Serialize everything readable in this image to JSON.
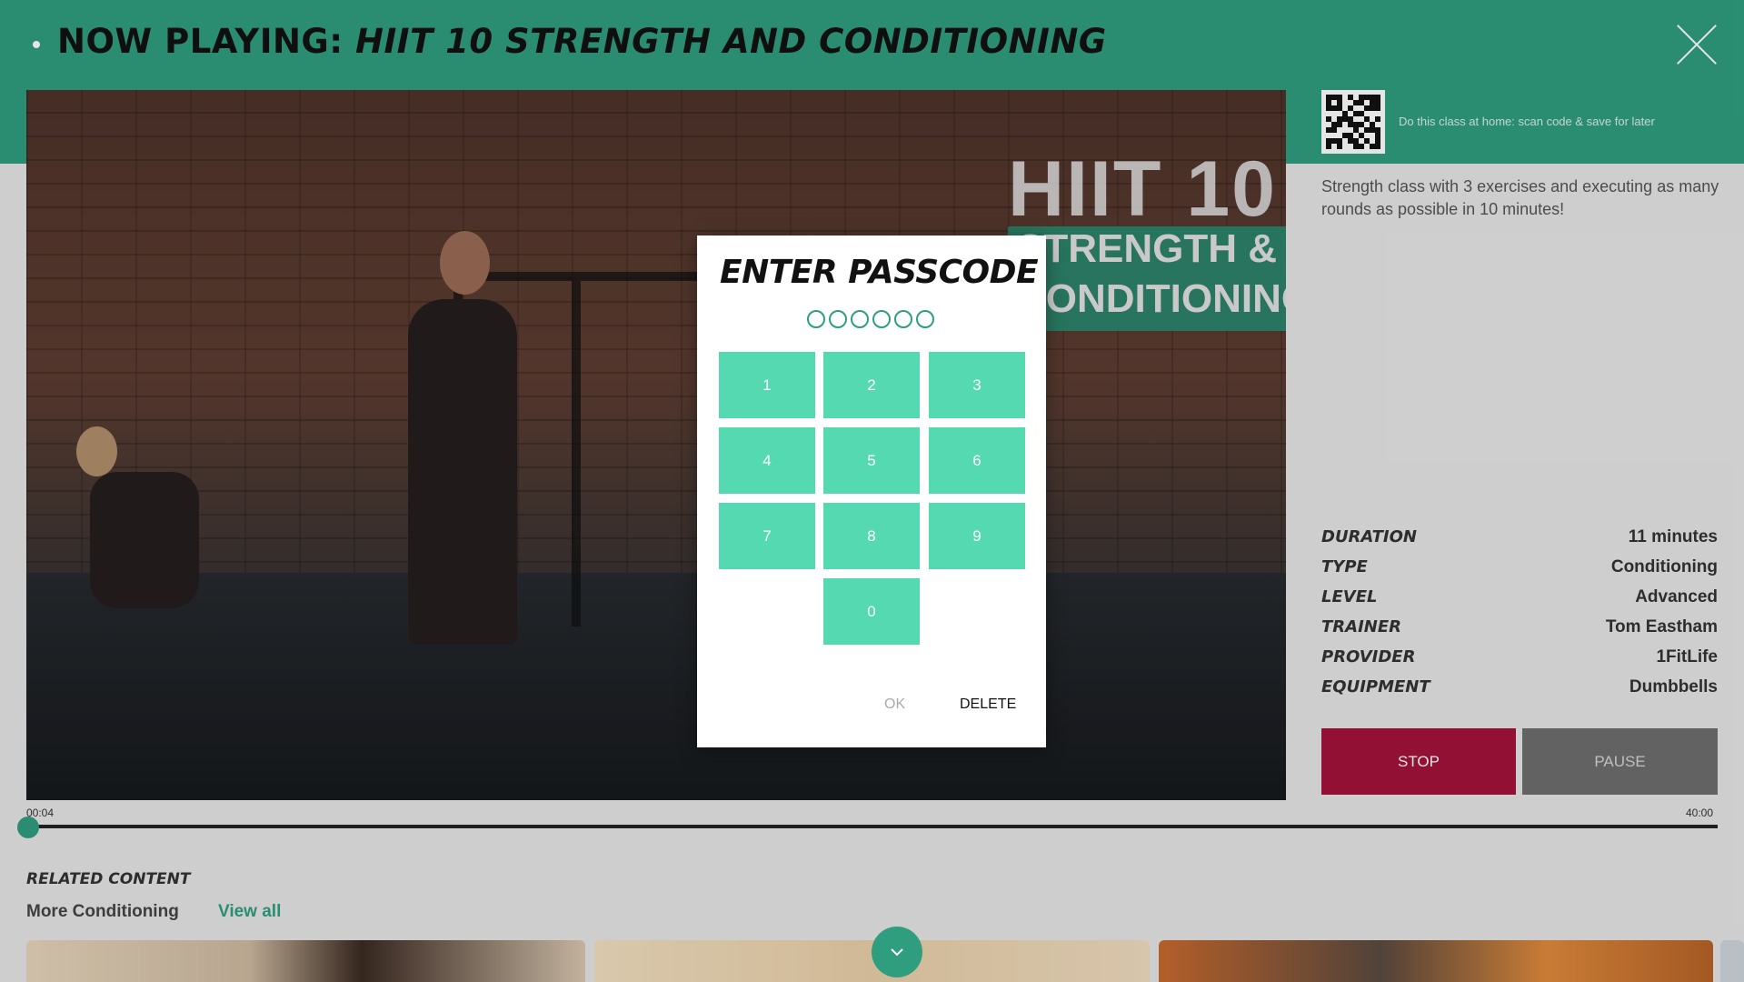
{
  "header": {
    "now_playing_prefix": "NOW PLAYING: ",
    "class_title": "HIIT 10 STRENGTH AND CONDITIONING"
  },
  "video": {
    "overlay_title": "HIIT 10",
    "overlay_line1": "STRENGTH &",
    "overlay_line2": "CONDITIONING"
  },
  "side": {
    "qr_caption": "Do this class at home: scan code & save for later",
    "description": "Strength class with 3 exercises and executing as many rounds as possible in 10 minutes!",
    "meta": [
      {
        "key": "DURATION",
        "value": "11 minutes"
      },
      {
        "key": "TYPE",
        "value": "Conditioning"
      },
      {
        "key": "LEVEL",
        "value": "Advanced"
      },
      {
        "key": "TRAINER",
        "value": "Tom Eastham"
      },
      {
        "key": "PROVIDER",
        "value": "1FitLife"
      },
      {
        "key": "EQUIPMENT",
        "value": "Dumbbells"
      }
    ],
    "stop_label": "STOP",
    "pause_label": "PAUSE"
  },
  "player": {
    "elapsed": "00:04",
    "total": "40:00",
    "progress_fraction": 0.0017
  },
  "related": {
    "title": "RELATED CONTENT",
    "subtitle": "More Conditioning",
    "view_all": "View all"
  },
  "modal": {
    "title": "ENTER PASSCODE",
    "digits_entered": 0,
    "digits_total": 6,
    "keys": [
      "1",
      "2",
      "3",
      "4",
      "5",
      "6",
      "7",
      "8",
      "9",
      "0"
    ],
    "ok_label": "OK",
    "delete_label": "DELETE"
  },
  "colors": {
    "accent": "#2f9e7f",
    "key": "#55d9b1",
    "stop": "#a3123a",
    "pause": "#6e6e6e"
  },
  "icons": {
    "close": "close-icon",
    "scroll_down": "chevron-down-icon"
  }
}
